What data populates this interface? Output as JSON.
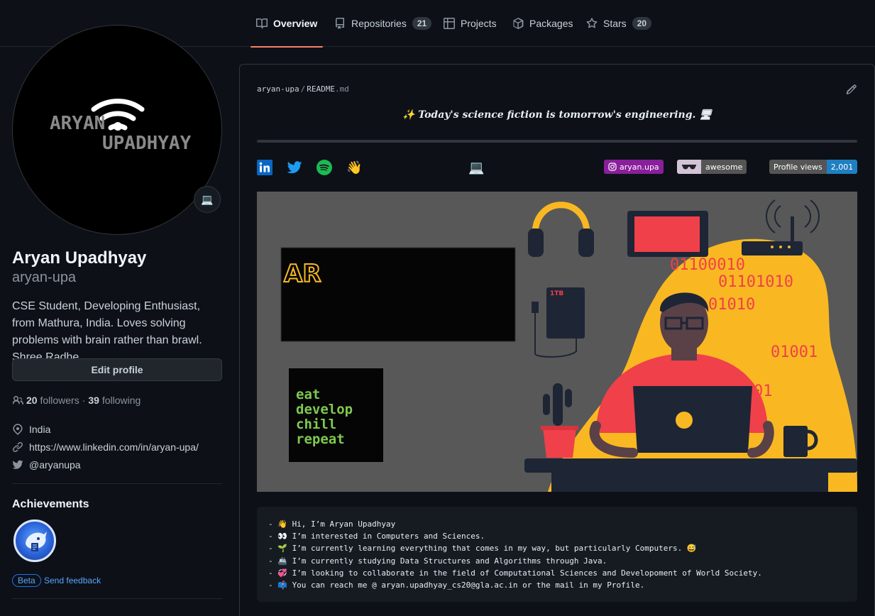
{
  "nav": {
    "tabs": [
      {
        "label": "Overview",
        "count": null,
        "icon": "book-icon"
      },
      {
        "label": "Repositories",
        "count": "21",
        "icon": "repo-icon"
      },
      {
        "label": "Projects",
        "count": null,
        "icon": "table-icon"
      },
      {
        "label": "Packages",
        "count": null,
        "icon": "package-icon"
      },
      {
        "label": "Stars",
        "count": "20",
        "icon": "star-icon"
      }
    ]
  },
  "profile": {
    "avatar_text_1": "ARYAN",
    "avatar_text_2": "UPADHYAY",
    "status_emoji": "💻",
    "full_name": "Aryan Upadhyay",
    "username": "aryan-upa",
    "bio": "CSE Student, Developing Enthusiast, from Mathura, India. Loves solving problems with brain rather than brawl. Shree Radhe.",
    "edit_label": "Edit profile",
    "followers_count": "20",
    "followers_label": "followers",
    "dot": "·",
    "following_count": "39",
    "following_label": "following",
    "location": "India",
    "website": "https://www.linkedin.com/in/aryan-upa/",
    "twitter": "@aryanupa"
  },
  "achievements": {
    "title": "Achievements",
    "beta_label": "Beta",
    "feedback_label": "Send feedback"
  },
  "readme": {
    "owner": "aryan-upa",
    "slash": "/",
    "file": "README",
    "ext": ".md",
    "quote": "✨ Today's science fiction is tomorrow's engineering. 🖥",
    "laptop_emoji": "💻",
    "wave_emoji": "👋",
    "shields": {
      "instagram": "aryan.upa",
      "awesome": "awesome",
      "views_label": "Profile views",
      "views_value": "2,001"
    },
    "banner": {
      "logo": "AR",
      "edcr": [
        "eat",
        "develop",
        "chill",
        "repeat"
      ],
      "binary": [
        "01100010",
        "01101010",
        "01010",
        "01001",
        "01"
      ],
      "drive_label": "1TB"
    },
    "lines": [
      "- 👋 Hi, I’m Aryan Upadhyay",
      "- 👀 I’m interested in Computers and Sciences.",
      "- 🌱 I’m currently learning everything that comes in my way, but particularly Computers. 😅",
      "- 🚢 I’m currently studying Data Structures and Algorithms through Java.",
      "- 💞️ I’m looking to collaborate in the field of Computational Sciences and Developoment of World Society.",
      "- 📫 You can reach me @ aryan.upadhyay_cs20@gla.ac.in or the mail in my Profile."
    ]
  },
  "colors": {
    "accent": "#f78166",
    "link": "#58a6ff",
    "banner_yellow": "#f9b822",
    "banner_red": "#f0404a"
  }
}
